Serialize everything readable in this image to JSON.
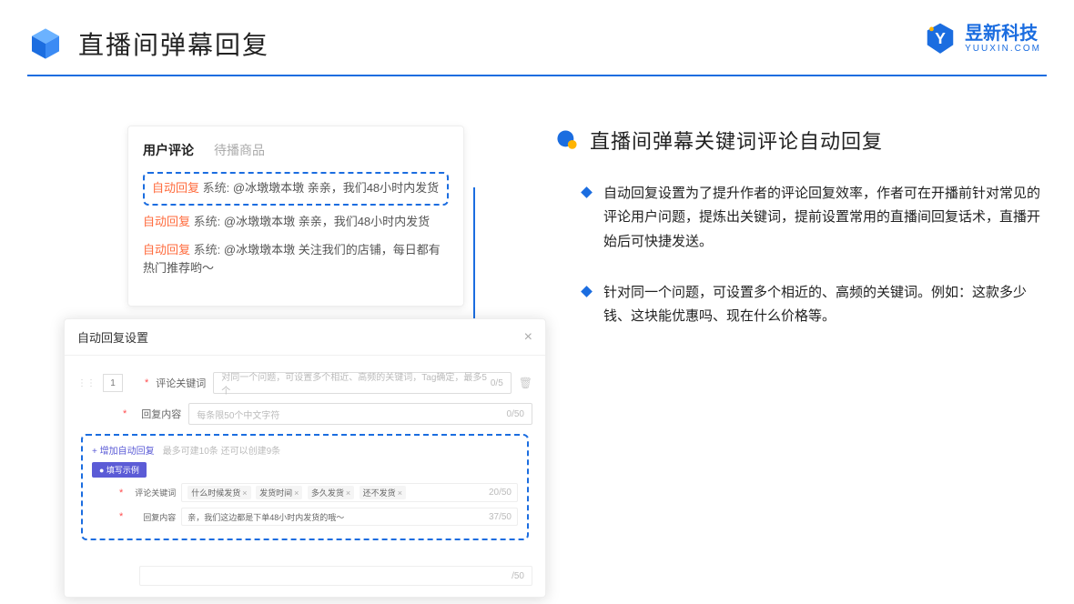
{
  "page_title": "直播间弹幕回复",
  "brand": {
    "cn": "昱新科技",
    "en": "YUUXIN.COM"
  },
  "comments": {
    "tab_active": "用户评论",
    "tab_inactive": "待播商品",
    "rows": [
      {
        "auto": "自动回复",
        "sys": "系统:",
        "text": "@冰墩墩本墩 亲亲，我们48小时内发货"
      },
      {
        "auto": "自动回复",
        "sys": "系统:",
        "text": "@冰墩墩本墩 亲亲，我们48小时内发货"
      },
      {
        "auto": "自动回复",
        "sys": "系统:",
        "text": "@冰墩墩本墩 关注我们的店铺，每日都有热门推荐哟～"
      }
    ]
  },
  "settings": {
    "title": "自动回复设置",
    "num": "1",
    "kw_label": "评论关键词",
    "kw_placeholder": "对同一个问题，可设置多个相近、高频的关键词，Tag确定，最多5个",
    "kw_counter": "0/5",
    "content_label": "回复内容",
    "content_placeholder": "每条限50个中文字符",
    "content_counter": "0/50",
    "add_text": "+ 增加自动回复",
    "add_hint": "最多可建10条 还可以创建9条",
    "example_badge": "● 填写示例",
    "ex_kw_label": "评论关键词",
    "ex_tags": [
      "什么时候发货",
      "发货时间",
      "多久发货",
      "还不发货"
    ],
    "ex_kw_counter": "20/50",
    "ex_content_label": "回复内容",
    "ex_content_value": "亲，我们这边都是下单48小时内发货的哦～",
    "ex_content_counter": "37/50",
    "cut_counter": "/50"
  },
  "right": {
    "section_title": "直播间弹幕关键词评论自动回复",
    "bullets": [
      "自动回复设置为了提升作者的评论回复效率，作者可在开播前针对常见的评论用户问题，提炼出关键词，提前设置常用的直播间回复话术，直播开始后可快捷发送。",
      "针对同一个问题，可设置多个相近的、高频的关键词。例如：这款多少钱、这块能优惠吗、现在什么价格等。"
    ]
  }
}
